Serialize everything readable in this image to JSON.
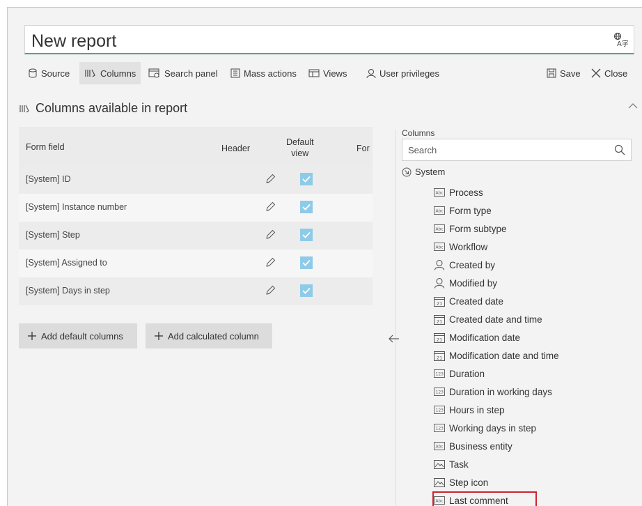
{
  "header": {
    "title": "New report"
  },
  "toolbar": {
    "source": "Source",
    "columns": "Columns",
    "search_panel": "Search panel",
    "mass_actions": "Mass actions",
    "views": "Views",
    "user_privileges": "User privileges",
    "save": "Save",
    "close": "Close"
  },
  "section": {
    "title": "Columns available in report"
  },
  "table": {
    "col_form_field": "Form field",
    "col_header": "Header",
    "col_default_view_1": "Default",
    "col_default_view_2": "view",
    "col_partial": "For",
    "rows": [
      {
        "label": "[System] ID",
        "default_view": true
      },
      {
        "label": "[System] Instance number",
        "default_view": true
      },
      {
        "label": "[System] Step",
        "default_view": true
      },
      {
        "label": "[System] Assigned to",
        "default_view": true
      },
      {
        "label": "[System] Days in step",
        "default_view": true
      }
    ]
  },
  "buttons": {
    "add_default": "Add default columns",
    "add_calculated": "Add calculated column"
  },
  "columns_panel": {
    "label": "Columns",
    "search_placeholder": "Search",
    "root": "System",
    "items": [
      {
        "label": "Process",
        "icon": "text-field-icon"
      },
      {
        "label": "Form type",
        "icon": "text-field-icon"
      },
      {
        "label": "Form subtype",
        "icon": "text-field-icon"
      },
      {
        "label": "Workflow",
        "icon": "text-field-icon"
      },
      {
        "label": "Created by",
        "icon": "user-icon"
      },
      {
        "label": "Modified by",
        "icon": "user-icon"
      },
      {
        "label": "Created date",
        "icon": "calendar-icon"
      },
      {
        "label": "Created date and time",
        "icon": "calendar-icon"
      },
      {
        "label": "Modification date",
        "icon": "calendar-icon"
      },
      {
        "label": "Modification date and time",
        "icon": "calendar-icon"
      },
      {
        "label": "Duration",
        "icon": "number-field-icon"
      },
      {
        "label": "Duration in working days",
        "icon": "number-field-icon"
      },
      {
        "label": "Hours in step",
        "icon": "number-field-icon"
      },
      {
        "label": "Working days in step",
        "icon": "number-field-icon"
      },
      {
        "label": "Business entity",
        "icon": "text-field-icon"
      },
      {
        "label": "Task",
        "icon": "image-icon"
      },
      {
        "label": "Step icon",
        "icon": "image-icon"
      },
      {
        "label": "Last comment",
        "icon": "text-field-icon",
        "highlighted": true
      }
    ]
  },
  "colors": {
    "accent_underline": "#5a9e98",
    "checkbox": "#8ecbe8",
    "highlight_border": "#d1222e"
  }
}
